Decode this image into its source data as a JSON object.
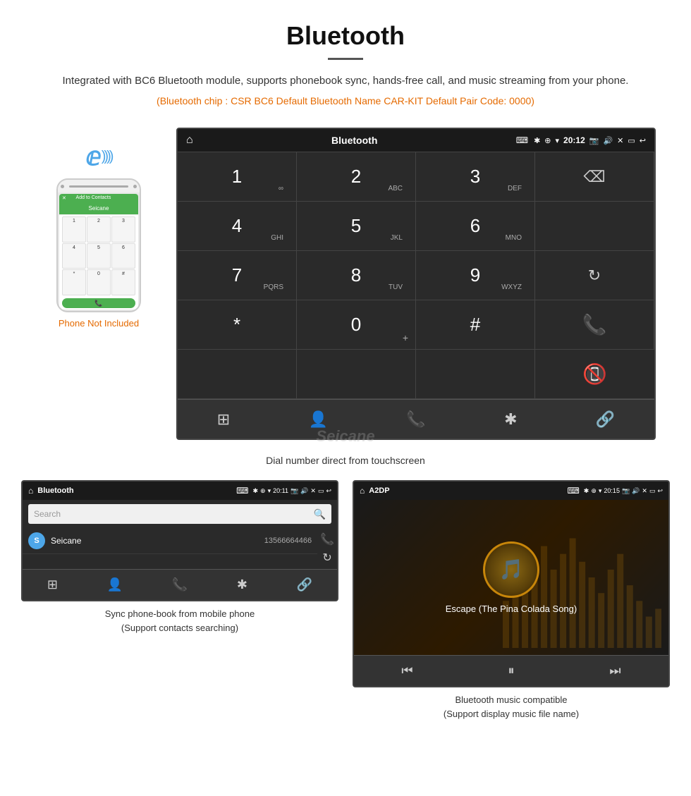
{
  "header": {
    "title": "Bluetooth",
    "description": "Integrated with BC6 Bluetooth module, supports phonebook sync, hands-free call, and music streaming from your phone.",
    "specs": "(Bluetooth chip : CSR BC6    Default Bluetooth Name CAR-KIT    Default Pair Code: 0000)"
  },
  "phone_widget": {
    "not_included_label": "Phone Not Included"
  },
  "main_screen": {
    "status_bar": {
      "home_icon": "⌂",
      "title": "Bluetooth",
      "usb_icon": "⌨",
      "time": "20:12"
    },
    "dialpad": {
      "keys": [
        {
          "label": "1",
          "sub": "∞"
        },
        {
          "label": "2",
          "sub": "ABC"
        },
        {
          "label": "3",
          "sub": "DEF"
        },
        {
          "label": "backspace",
          "sub": ""
        },
        {
          "label": "4",
          "sub": "GHI"
        },
        {
          "label": "5",
          "sub": "JKL"
        },
        {
          "label": "6",
          "sub": "MNO"
        },
        {
          "label": "",
          "sub": ""
        },
        {
          "label": "7",
          "sub": "PQRS"
        },
        {
          "label": "8",
          "sub": "TUV"
        },
        {
          "label": "9",
          "sub": "WXYZ"
        },
        {
          "label": "refresh",
          "sub": ""
        },
        {
          "label": "*",
          "sub": ""
        },
        {
          "label": "0+",
          "sub": ""
        },
        {
          "label": "#",
          "sub": ""
        },
        {
          "label": "call",
          "sub": ""
        },
        {
          "label": "",
          "sub": ""
        },
        {
          "label": "",
          "sub": ""
        },
        {
          "label": "",
          "sub": ""
        },
        {
          "label": "hangup",
          "sub": ""
        }
      ]
    },
    "bottom_nav": [
      "grid",
      "person",
      "phone",
      "bluetooth",
      "link"
    ]
  },
  "caption_main": "Dial number direct from touchscreen",
  "phonebook_screen": {
    "status_bar": {
      "title": "Bluetooth",
      "time": "20:11"
    },
    "search_placeholder": "Search",
    "contacts": [
      {
        "initial": "S",
        "name": "Seicane",
        "phone": "13566664466"
      }
    ],
    "bottom_nav": [
      "grid",
      "person",
      "phone",
      "bluetooth",
      "link"
    ]
  },
  "music_screen": {
    "status_bar": {
      "title": "A2DP",
      "time": "20:15"
    },
    "song_title": "Escape (The Pina Colada Song)",
    "controls": [
      "prev",
      "play-pause",
      "next"
    ]
  },
  "caption_phonebook": "Sync phone-book from mobile phone\n(Support contacts searching)",
  "caption_music": "Bluetooth music compatible\n(Support display music file name)",
  "watermark": "Seicane"
}
